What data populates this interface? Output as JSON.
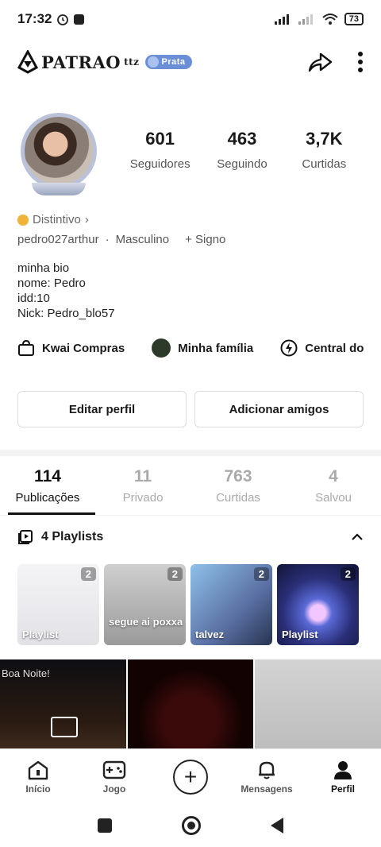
{
  "status_bar": {
    "time": "17:32",
    "battery": "73"
  },
  "header": {
    "logo_text": "PATRAO",
    "logo_sup": "ttz",
    "rank_badge": "Prata"
  },
  "profile": {
    "stats": [
      {
        "value": "601",
        "label": "Seguidores"
      },
      {
        "value": "463",
        "label": "Seguindo"
      },
      {
        "value": "3,7K",
        "label": "Curtidas"
      }
    ],
    "distintivo": "Distintivo",
    "username": "pedro027arthur",
    "gender": "Masculino",
    "sign": "+ Signo",
    "bio_lines": [
      "minha bio",
      "nome: Pedro",
      "idd:10",
      "Nick: Pedro_blo57"
    ]
  },
  "quick_links": [
    {
      "label": "Kwai Compras",
      "icon": "shopping-bag-icon"
    },
    {
      "label": "Minha família",
      "icon": "family-avatar"
    },
    {
      "label": "Central do",
      "icon": "lightning-icon"
    }
  ],
  "buttons": {
    "edit": "Editar perfil",
    "add_friends": "Adicionar amigos"
  },
  "tabs": [
    {
      "count": "114",
      "label": "Publicações"
    },
    {
      "count": "11",
      "label": "Privado"
    },
    {
      "count": "763",
      "label": "Curtidas"
    },
    {
      "count": "4",
      "label": "Salvou"
    }
  ],
  "playlists": {
    "title": "4 Playlists",
    "items": [
      {
        "count": "2",
        "caption": "Playlist"
      },
      {
        "count": "2",
        "caption": "segue ai poxxa"
      },
      {
        "count": "2",
        "caption": "talvez"
      },
      {
        "count": "2",
        "caption": "Playlist"
      }
    ]
  },
  "grid": {
    "first_caption": "Boa Noite!"
  },
  "bottom_nav": {
    "home": "Início",
    "game": "Jogo",
    "messages": "Mensagens",
    "profile": "Perfil"
  }
}
